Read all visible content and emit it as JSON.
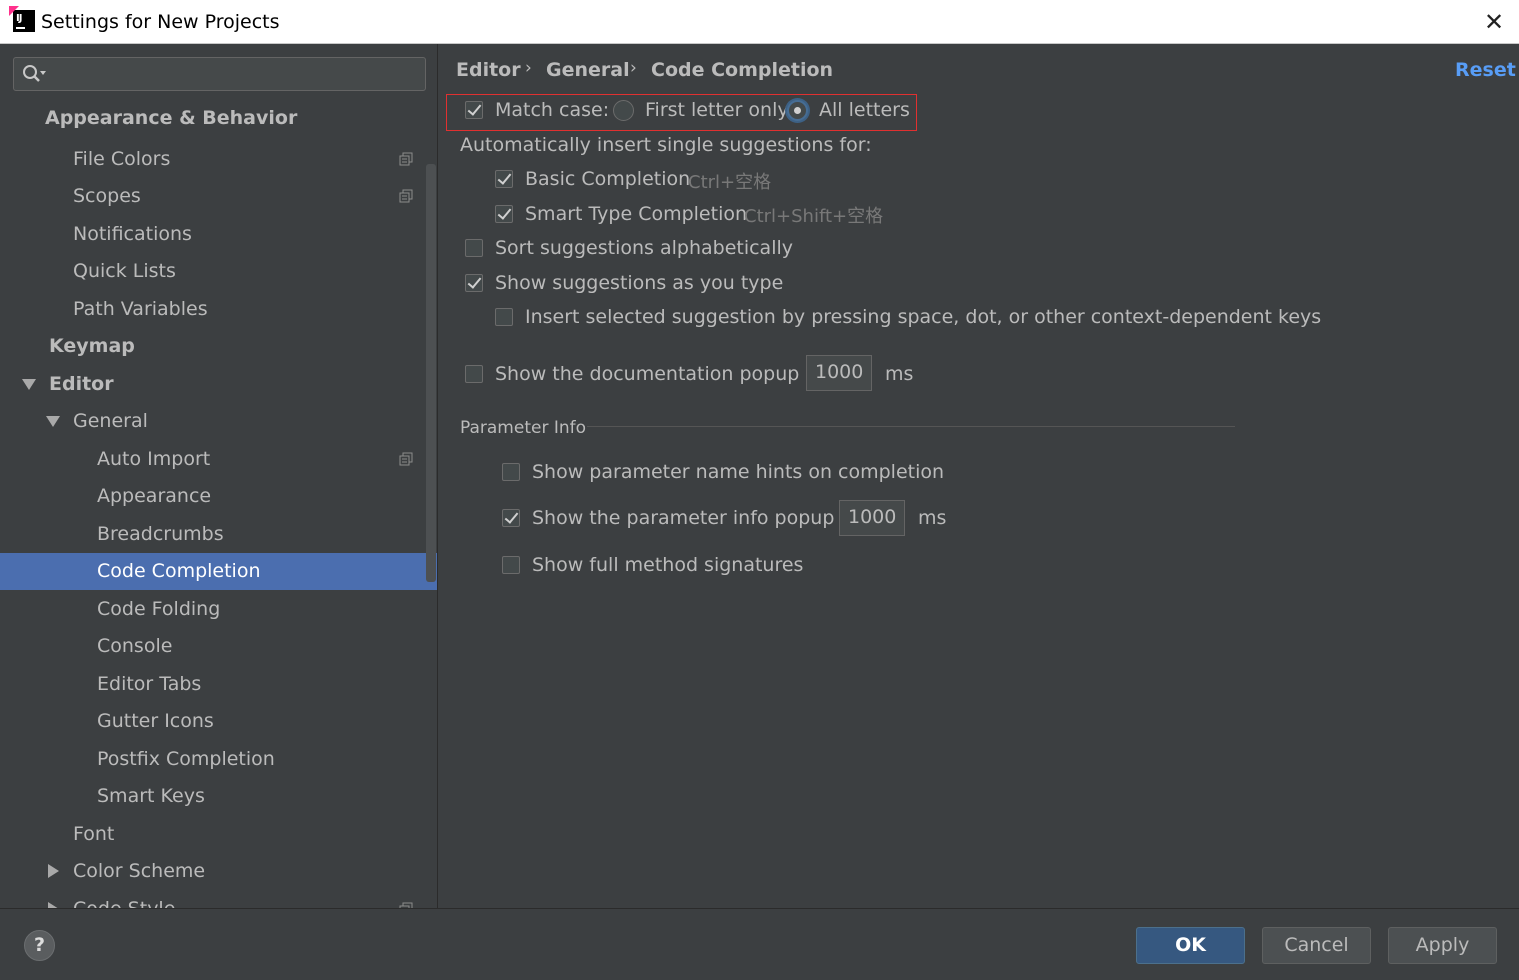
{
  "window": {
    "title": "Settings for New Projects",
    "app_icon_text": "IJ"
  },
  "search": {
    "placeholder": ""
  },
  "sidebar": {
    "items": [
      {
        "label": "Appearance & Behavior"
      },
      {
        "label": "File Colors"
      },
      {
        "label": "Scopes"
      },
      {
        "label": "Notifications"
      },
      {
        "label": "Quick Lists"
      },
      {
        "label": "Path Variables"
      },
      {
        "label": "Keymap"
      },
      {
        "label": "Editor"
      },
      {
        "label": "General"
      },
      {
        "label": "Auto Import"
      },
      {
        "label": "Appearance"
      },
      {
        "label": "Breadcrumbs"
      },
      {
        "label": "Code Completion",
        "selected": true
      },
      {
        "label": "Code Folding"
      },
      {
        "label": "Console"
      },
      {
        "label": "Editor Tabs"
      },
      {
        "label": "Gutter Icons"
      },
      {
        "label": "Postfix Completion"
      },
      {
        "label": "Smart Keys"
      },
      {
        "label": "Font"
      },
      {
        "label": "Color Scheme"
      },
      {
        "label": "Code Style"
      }
    ]
  },
  "breadcrumb": {
    "items": [
      "Editor",
      "General",
      "Code Completion"
    ],
    "separator": "›"
  },
  "reset_label": "Reset",
  "settings": {
    "match_case": {
      "label": "Match case:",
      "checked": true
    },
    "first_letter_only": {
      "label": "First letter only",
      "selected": false
    },
    "all_letters": {
      "label": "All letters",
      "selected": true
    },
    "auto_insert_heading": "Automatically insert single suggestions for:",
    "basic_completion": {
      "label": "Basic Completion",
      "shortcut": "Ctrl+空格",
      "checked": true
    },
    "smart_type_completion": {
      "label": "Smart Type Completion",
      "shortcut": "Ctrl+Shift+空格",
      "checked": true
    },
    "sort_alpha": {
      "label": "Sort suggestions alphabetically",
      "checked": false
    },
    "show_as_you_type": {
      "label": "Show suggestions as you type",
      "checked": true
    },
    "insert_selected": {
      "label": "Insert selected suggestion by pressing space, dot, or other context-dependent keys",
      "checked": false
    },
    "doc_popup": {
      "label": "Show the documentation popup in",
      "value": "1000",
      "unit": "ms",
      "checked": false
    },
    "parameter_info_title": "Parameter Info",
    "param_name_hints": {
      "label": "Show parameter name hints on completion",
      "checked": false
    },
    "param_info_popup": {
      "label": "Show the parameter info popup in",
      "value": "1000",
      "unit": "ms",
      "checked": true
    },
    "full_signatures": {
      "label": "Show full method signatures",
      "checked": false
    }
  },
  "footer": {
    "help": "?",
    "ok": "OK",
    "cancel": "Cancel",
    "apply": "Apply"
  }
}
